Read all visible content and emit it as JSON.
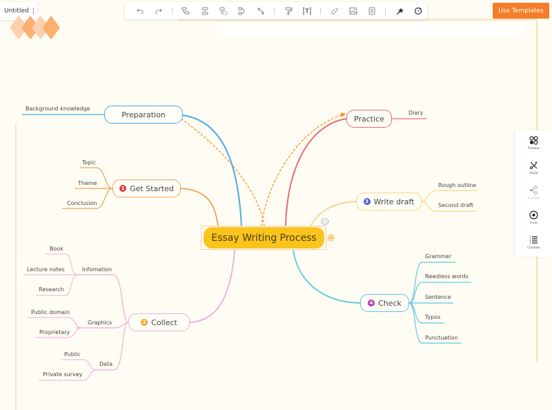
{
  "app": {
    "document_title": "Untitled",
    "use_templates_label": "Use Templates",
    "accent_color": "#f47d2a"
  },
  "toolbar": {
    "groups": [
      [
        {
          "icon": "undo-icon",
          "label": "Undo"
        },
        {
          "icon": "redo-icon",
          "label": "Redo"
        }
      ],
      [
        {
          "icon": "add-topic-icon",
          "label": "Topic"
        },
        {
          "icon": "add-sibling-icon",
          "label": "Sibling"
        },
        {
          "icon": "add-subtopic-icon",
          "label": "Subtopic"
        },
        {
          "icon": "relationship-icon",
          "label": "Relationship"
        },
        {
          "icon": "summary-icon",
          "label": "Summary"
        }
      ],
      [
        {
          "icon": "format-painter-icon",
          "label": "Format painter"
        },
        {
          "icon": "text-box-icon",
          "label": "Text"
        }
      ],
      [
        {
          "icon": "link-icon",
          "label": "Link"
        },
        {
          "icon": "image-icon",
          "label": "Image"
        },
        {
          "icon": "note-icon",
          "label": "Note"
        }
      ],
      [
        {
          "icon": "magic-wand-icon",
          "label": "AI"
        },
        {
          "icon": "navigation-icon",
          "label": "Navigate"
        }
      ]
    ]
  },
  "side_panel": {
    "items": [
      {
        "label": "Theme",
        "icon": "theme-icon",
        "enabled": true
      },
      {
        "label": "Style",
        "icon": "style-icon",
        "enabled": true
      },
      {
        "label": "Layout",
        "icon": "layout-icon",
        "enabled": false
      },
      {
        "label": "Icon",
        "icon": "icon-icon",
        "enabled": true
      },
      {
        "label": "Outline",
        "icon": "outline-icon",
        "enabled": true
      }
    ]
  },
  "mindmap": {
    "root": "Essay Writing Process",
    "branches": {
      "preparation": {
        "label": "Preparation",
        "color": "#4aa8e8",
        "children": [
          "Background knowledge"
        ]
      },
      "get_started": {
        "label": "Get Started",
        "badge": "1",
        "badge_color": "#e03b3b",
        "color": "#efa05a",
        "children": [
          "Topic",
          "Theme",
          "Conclusion"
        ]
      },
      "collect": {
        "label": "Collect",
        "badge": "2",
        "badge_color": "#f5a623",
        "color": "#f2a9dc",
        "subgroups": [
          {
            "label": "Infomation",
            "children": [
              "Book",
              "Lecture notes",
              "Research"
            ]
          },
          {
            "label": "Graphics",
            "children": [
              "Public domain",
              "Proprietary"
            ]
          },
          {
            "label": "Data",
            "children": [
              "Public",
              "Private survey"
            ]
          }
        ]
      },
      "practice": {
        "label": "Practice",
        "color": "#e86a72",
        "children": [
          "Diary"
        ]
      },
      "write_draft": {
        "label": "Write draft",
        "badge": "3",
        "badge_color": "#4a63d8",
        "color": "#f7d38a",
        "children": [
          "Rough outline",
          "Second draft"
        ]
      },
      "check": {
        "label": "Check",
        "badge": "4",
        "badge_color": "#b43cb4",
        "color": "#5bc6e0",
        "children": [
          "Grammer",
          "Needless words",
          "Sentence",
          "Typos",
          "Punctuation"
        ]
      }
    },
    "relationship_color": "#f4901e"
  }
}
